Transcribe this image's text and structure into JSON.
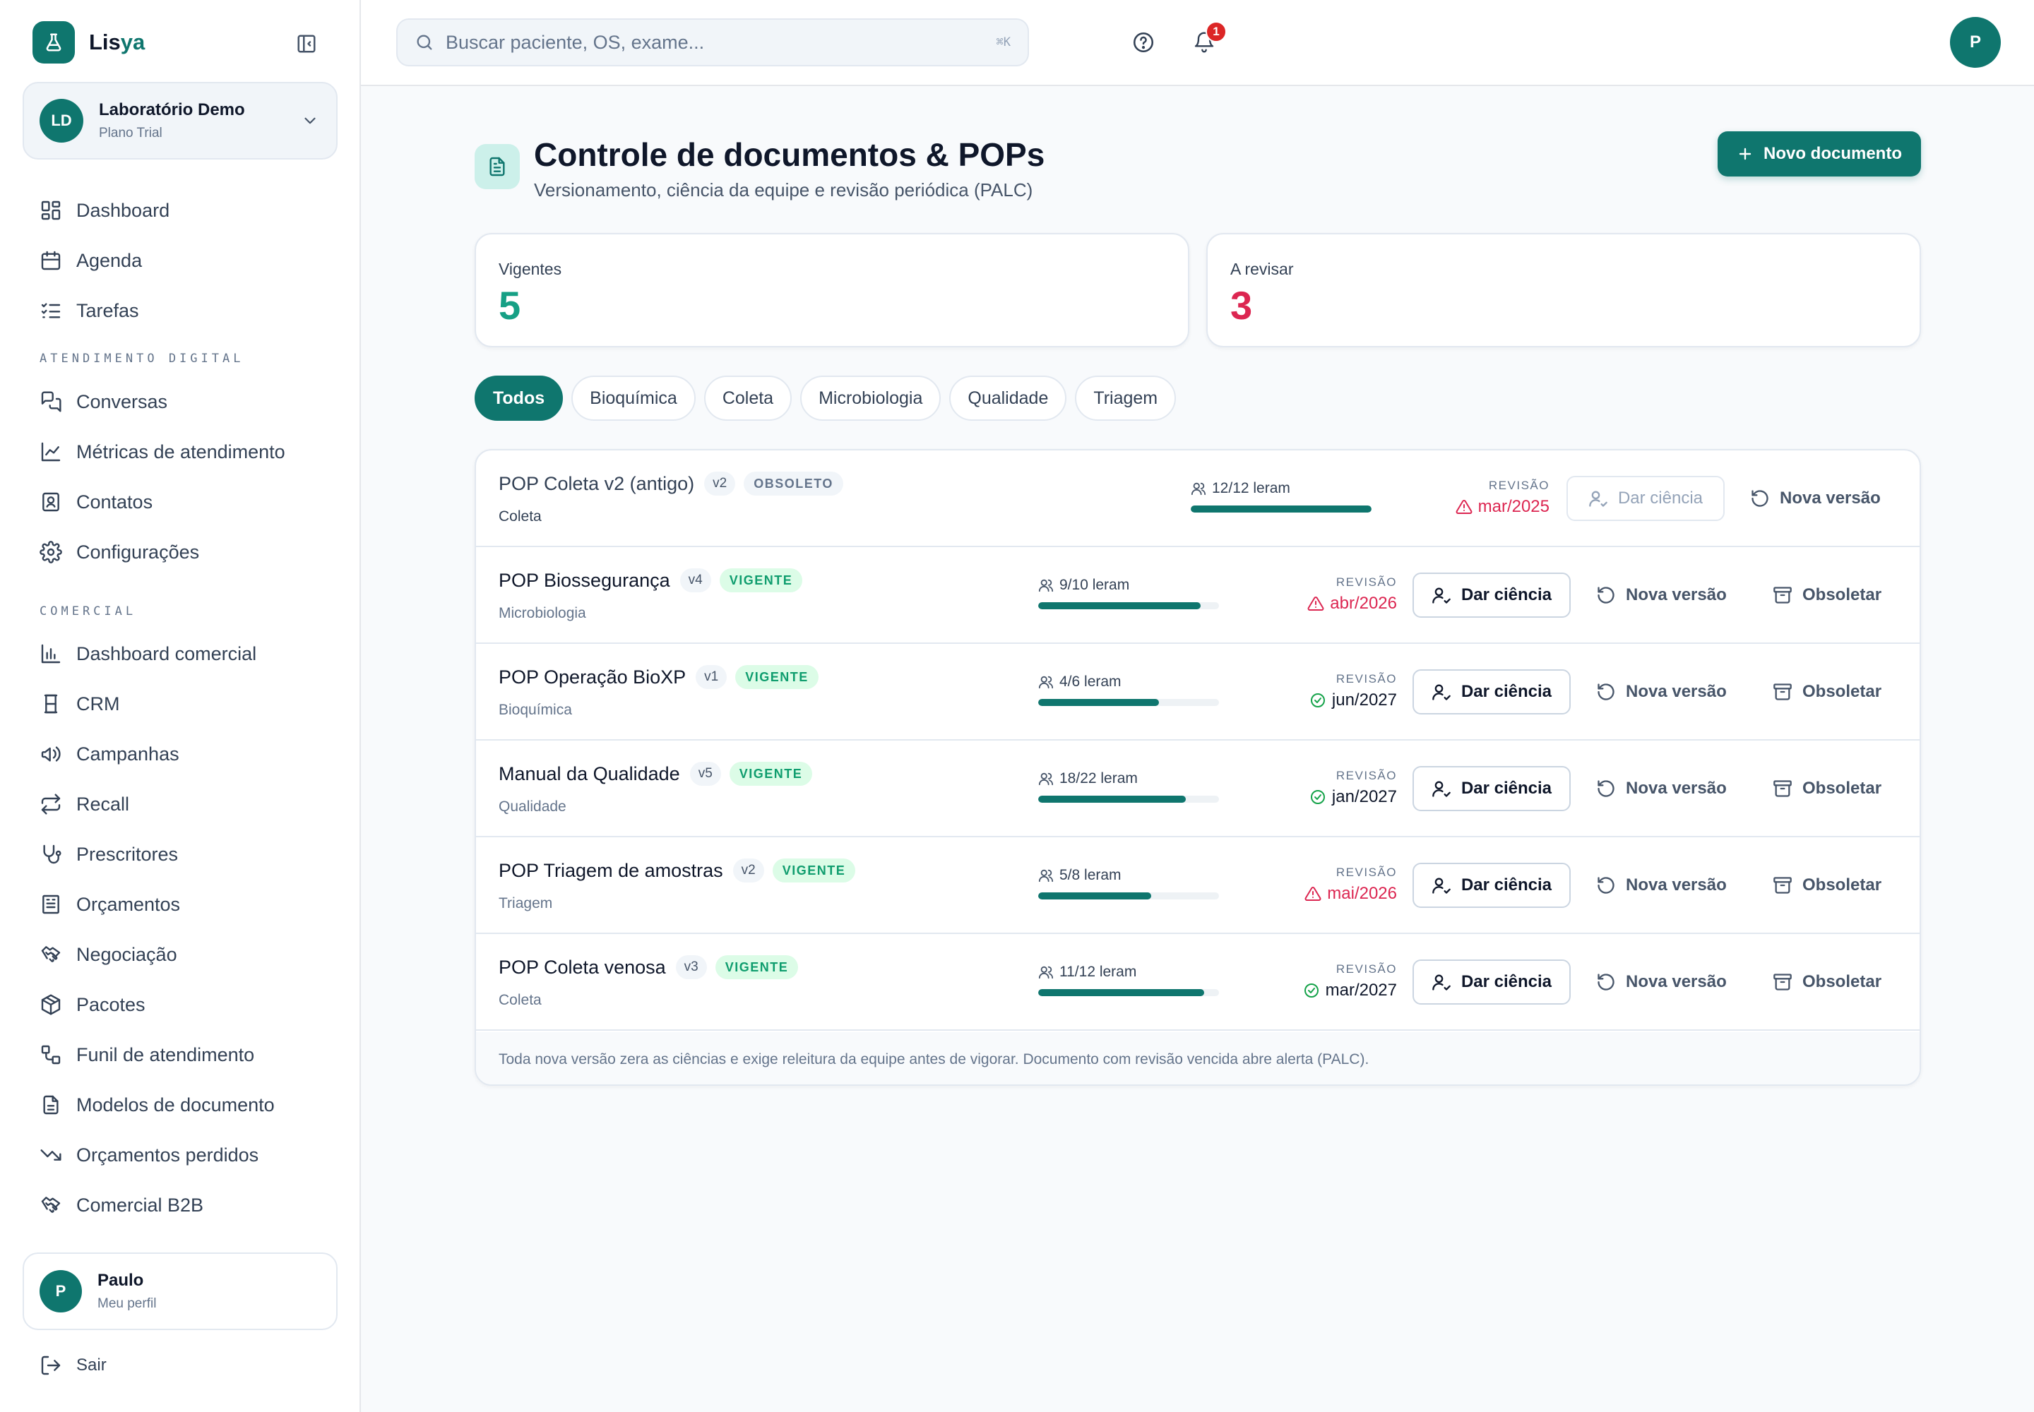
{
  "brand": {
    "name_part1": "Lis",
    "name_part2": "ya"
  },
  "org": {
    "initials": "LD",
    "name": "Laboratório Demo",
    "plan": "Plano Trial"
  },
  "nav": {
    "main": [
      {
        "label": "Dashboard",
        "icon": "dashboard-icon"
      },
      {
        "label": "Agenda",
        "icon": "calendar-icon"
      },
      {
        "label": "Tarefas",
        "icon": "checklist-icon"
      }
    ],
    "section_digital": "ATENDIMENTO DIGITAL",
    "digital": [
      {
        "label": "Conversas",
        "icon": "chat-icon"
      },
      {
        "label": "Métricas de atendimento",
        "icon": "line-chart-icon"
      },
      {
        "label": "Contatos",
        "icon": "contact-icon"
      },
      {
        "label": "Configurações",
        "icon": "gear-icon"
      }
    ],
    "section_comercial": "COMERCIAL",
    "comercial": [
      {
        "label": "Dashboard comercial",
        "icon": "bar-chart-icon"
      },
      {
        "label": "CRM",
        "icon": "crm-icon"
      },
      {
        "label": "Campanhas",
        "icon": "megaphone-icon"
      },
      {
        "label": "Recall",
        "icon": "repeat-icon"
      },
      {
        "label": "Prescritores",
        "icon": "stethoscope-icon"
      },
      {
        "label": "Orçamentos",
        "icon": "receipt-icon"
      },
      {
        "label": "Negociação",
        "icon": "handshake-icon"
      },
      {
        "label": "Pacotes",
        "icon": "package-icon"
      },
      {
        "label": "Funil de atendimento",
        "icon": "workflow-icon"
      },
      {
        "label": "Modelos de documento",
        "icon": "document-icon"
      },
      {
        "label": "Orçamentos perdidos",
        "icon": "trending-down-icon"
      },
      {
        "label": "Comercial B2B",
        "icon": "handshake-icon"
      }
    ]
  },
  "profile": {
    "initial": "P",
    "name": "Paulo",
    "sub": "Meu perfil",
    "logout": "Sair"
  },
  "topbar": {
    "search_placeholder": "Buscar paciente, OS, exame...",
    "shortcut": "⌘K",
    "notif_count": "1",
    "user_initial": "P"
  },
  "page": {
    "title": "Controle de documentos & POPs",
    "subtitle": "Versionamento, ciência da equipe e revisão periódica (PALC)",
    "new_button": "Novo documento"
  },
  "stats": [
    {
      "label": "Vigentes",
      "value": "5",
      "color": "#16a085"
    },
    {
      "label": "A revisar",
      "value": "3",
      "color": "#dc2651"
    }
  ],
  "filters": [
    "Todos",
    "Bioquímica",
    "Coleta",
    "Microbiologia",
    "Qualidade",
    "Triagem"
  ],
  "active_filter": "Todos",
  "review_label": "REVISÃO",
  "actions": {
    "ciencia": "Dar ciência",
    "nova_versao": "Nova versão",
    "obsoletar": "Obsoletar"
  },
  "documents": [
    {
      "title": "POP Coleta v2 (antigo)",
      "version": "v2",
      "status": "OBSOLETO",
      "category": "Coleta",
      "readers": "12/12 leram",
      "read": 12,
      "total": 12,
      "review": "mar/2025",
      "overdue": true
    },
    {
      "title": "POP Biossegurança",
      "version": "v4",
      "status": "VIGENTE",
      "category": "Microbiologia",
      "readers": "9/10 leram",
      "read": 9,
      "total": 10,
      "review": "abr/2026",
      "overdue": true
    },
    {
      "title": "POP Operação BioXP",
      "version": "v1",
      "status": "VIGENTE",
      "category": "Bioquímica",
      "readers": "4/6 leram",
      "read": 4,
      "total": 6,
      "review": "jun/2027",
      "overdue": false
    },
    {
      "title": "Manual da Qualidade",
      "version": "v5",
      "status": "VIGENTE",
      "category": "Qualidade",
      "readers": "18/22 leram",
      "read": 18,
      "total": 22,
      "review": "jan/2027",
      "overdue": false
    },
    {
      "title": "POP Triagem de amostras",
      "version": "v2",
      "status": "VIGENTE",
      "category": "Triagem",
      "readers": "5/8 leram",
      "read": 5,
      "total": 8,
      "review": "mai/2026",
      "overdue": true
    },
    {
      "title": "POP Coleta venosa",
      "version": "v3",
      "status": "VIGENTE",
      "category": "Coleta",
      "readers": "11/12 leram",
      "read": 11,
      "total": 12,
      "review": "mar/2027",
      "overdue": false
    }
  ],
  "footer_note": "Toda nova versão zera as ciências e exige releitura da equipe antes de vigorar. Documento com revisão vencida abre alerta (PALC)."
}
